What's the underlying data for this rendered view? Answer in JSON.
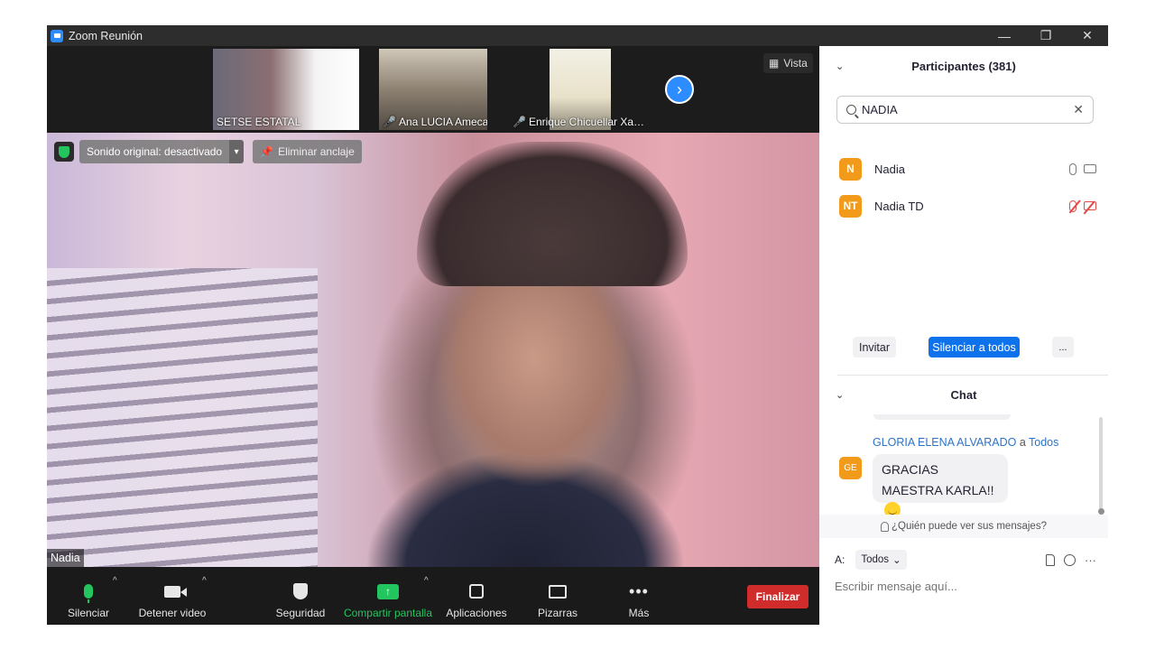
{
  "window": {
    "title": "Zoom Reunión",
    "minimize": "—",
    "restore": "❐",
    "close": "✕"
  },
  "thumbnails": [
    {
      "name": "SETSE ESTATAL",
      "muted": false
    },
    {
      "name": "Ana LUCIA Ameca",
      "muted": true
    },
    {
      "name": "Enrique Chicuellar Xa…",
      "muted": true
    }
  ],
  "thumbbar": {
    "next_glyph": "›",
    "view_label": "Vista"
  },
  "main_video": {
    "sound_label": "Sonido original: desactivado",
    "sound_caret": "▾",
    "unpin_label": "Eliminar anclaje",
    "speaker_name": "Nadia"
  },
  "toolbar": {
    "mute_label": "Silenciar",
    "video_label": "Detener video",
    "security_label": "Seguridad",
    "share_label": "Compartir pantalla",
    "apps_label": "Aplicaciones",
    "whiteboard_label": "Pizarras",
    "more_label": "Más",
    "end_label": "Finalizar",
    "caret": "^",
    "share_arrow": "↑",
    "more_glyph": "•••"
  },
  "participants": {
    "title": "Participantes (381)",
    "search_value": "NADIA",
    "clear_glyph": "✕",
    "list": [
      {
        "initials": "N",
        "name": "Nadia",
        "mic": "on",
        "cam": "on"
      },
      {
        "initials": "NT",
        "name": "Nadia TD",
        "mic": "off",
        "cam": "off"
      }
    ],
    "invite_label": "Invitar",
    "mute_all_label": "Silenciar a todos",
    "more_label": "..."
  },
  "chat": {
    "title": "Chat",
    "message": {
      "sender": "GLORIA ELENA ALVARADO",
      "connector": "a",
      "recipient": "Todos",
      "avatar": "GE",
      "text": "GRACIAS MAESTRA KARLA!!"
    },
    "who_sees": "¿Quién puede ver sus mensajes?",
    "to_label": "A:",
    "to_value": "Todos",
    "more_glyph": "···",
    "placeholder": "Escribir mensaje aquí..."
  },
  "colors": {
    "accent": "#0e72ed",
    "end": "#d12c2c",
    "green": "#23c55e",
    "avatar": "#f29a19"
  }
}
